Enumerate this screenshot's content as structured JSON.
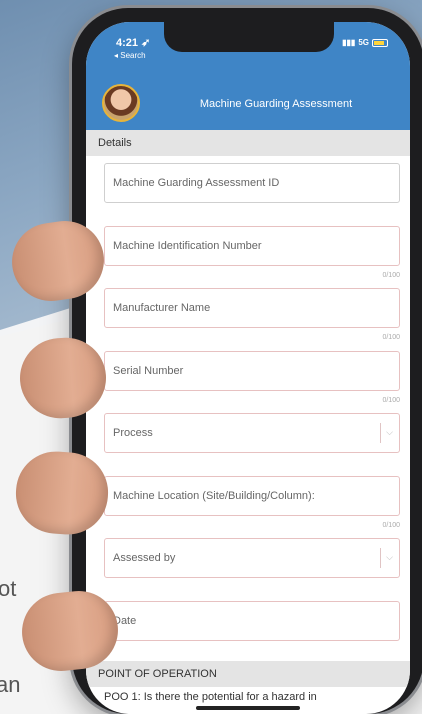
{
  "background": {
    "text_line_1": "ot",
    "text_line_2": "an"
  },
  "status_bar": {
    "time": "4:21",
    "back_label": "◂ Search",
    "network": "5G"
  },
  "header": {
    "title": "Machine Guarding Assessment"
  },
  "sections": {
    "details": "Details",
    "point_of_operation": "POINT OF OPERATION"
  },
  "fields": [
    {
      "label": "Machine Guarding Assessment ID",
      "counter": ""
    },
    {
      "label": "Machine Identification Number",
      "counter": "0/100"
    },
    {
      "label": "Manufacturer Name",
      "counter": "0/100"
    },
    {
      "label": "Serial Number",
      "counter": "0/100"
    },
    {
      "label": "Process",
      "counter": ""
    },
    {
      "label": "Machine Location (Site/Building/Column):",
      "counter": "0/100"
    },
    {
      "label": "Assessed by",
      "counter": ""
    },
    {
      "label": "Date",
      "counter": ""
    }
  ],
  "question_preview": "POO 1: Is there the potential for a hazard in",
  "colors": {
    "header_blue": "#3f85c6",
    "field_border": "#e7c1c1",
    "section_gray": "#e4e4e4"
  }
}
